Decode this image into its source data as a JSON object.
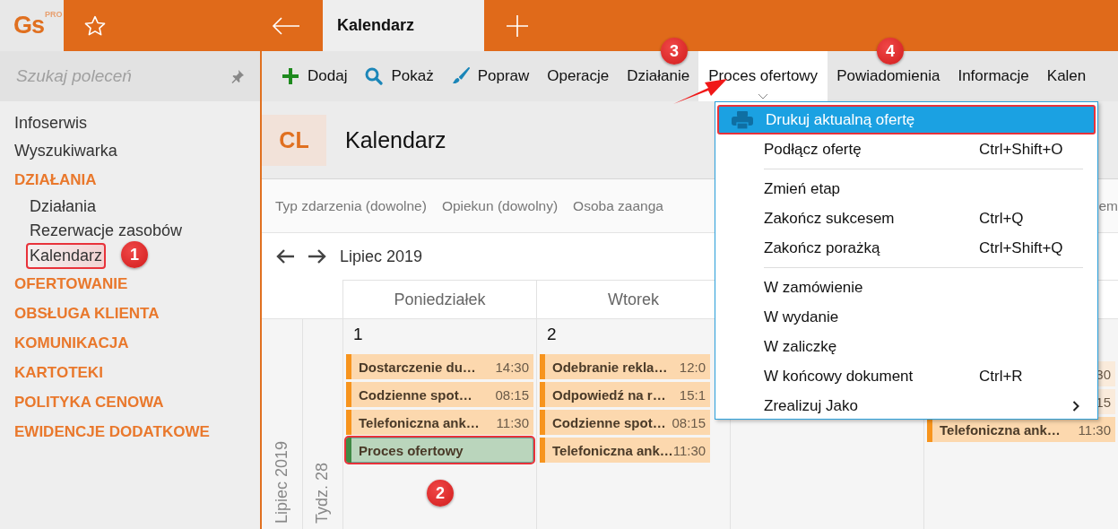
{
  "app": {
    "logo": "Gs",
    "logo_badge": "PRO"
  },
  "top_bar": {
    "tab": {
      "label": "Kalendarz",
      "selected": true
    }
  },
  "sidebar": {
    "search": {
      "placeholder": "Szukaj poleceń"
    },
    "items": [
      {
        "kind": "link",
        "label": "Infoserwis"
      },
      {
        "kind": "link",
        "label": "Wyszukiwarka"
      },
      {
        "kind": "section",
        "label": "DZIAŁANIA",
        "children": [
          {
            "label": "Działania",
            "selected": false
          },
          {
            "label": "Rezerwacje zasobów",
            "selected": false
          },
          {
            "label": "Kalendarz",
            "selected": true
          }
        ]
      },
      {
        "kind": "section",
        "label": "OFERTOWANIE"
      },
      {
        "kind": "section",
        "label": "OBSŁUGA KLIENTA"
      },
      {
        "kind": "section",
        "label": "KOMUNIKACJA"
      },
      {
        "kind": "section",
        "label": "KARTOTEKI"
      },
      {
        "kind": "section",
        "label": "POLITYKA CENOWA"
      },
      {
        "kind": "section",
        "label": "EWIDENCJE DODATKOWE"
      }
    ]
  },
  "toolbar": {
    "items": [
      {
        "kind": "add",
        "label": "Dodaj",
        "selected": false
      },
      {
        "kind": "search",
        "label": "Pokaż",
        "selected": false
      },
      {
        "kind": "edit",
        "label": "Popraw",
        "selected": false
      },
      {
        "kind": "plain",
        "label": "Operacje",
        "selected": false
      },
      {
        "kind": "plain",
        "label": "Działanie",
        "selected": false
      },
      {
        "kind": "plain",
        "label": "Proces ofertowy",
        "selected": true
      },
      {
        "kind": "plain",
        "label": "Powiadomienia",
        "selected": false
      },
      {
        "kind": "plain",
        "label": "Informacje",
        "selected": false
      },
      {
        "kind": "plain",
        "label": "Kalen",
        "selected": false
      }
    ]
  },
  "page_header": {
    "badge": "CL",
    "title": "Kalendarz"
  },
  "filters": [
    "Typ zdarzenia (dowolne)",
    "Opiekun (dowolny)",
    "Osoba zaanga",
    "em"
  ],
  "navigation": {
    "period": "Lipiec 2019"
  },
  "calendar": {
    "month_label": "Lipiec 2019",
    "week_label": "Tydz. 28",
    "columns": [
      {
        "header": "Poniedziałek",
        "day": "1",
        "events": [
          {
            "title": "Dostarczenie du…",
            "time": "14:30",
            "color": "#f7941d",
            "selected": false
          },
          {
            "title": "Codzienne spot…",
            "time": "08:15",
            "color": "#f7941d",
            "selected": false
          },
          {
            "title": "Telefoniczna ank…",
            "time": "11:30",
            "color": "#f7941d",
            "selected": false
          },
          {
            "title": "Proces ofertowy",
            "color": "#3f8a45",
            "selected": true
          }
        ]
      },
      {
        "header": "Wtorek",
        "day": "2",
        "events": [
          {
            "title": "Odebranie rekla…",
            "time": "12:0",
            "color": "#f7941d",
            "selected": false
          },
          {
            "title": "Odpowiedź na r…",
            "time": "15:1",
            "color": "#f7941d",
            "selected": false
          },
          {
            "title": "Codzienne spot…",
            "time": "08:15",
            "color": "#f7941d",
            "selected": false
          },
          {
            "title": "Telefoniczna ank…",
            "time": "11:30",
            "color": "#f7941d",
            "selected": false
          }
        ]
      },
      {},
      {
        "events": [
          {
            "time": "30",
            "selected": false
          },
          {
            "time": "15",
            "selected": false
          },
          {
            "title": "Telefoniczna ank…",
            "time": "11:30",
            "color": "#f7941d",
            "selected": false
          }
        ]
      }
    ]
  },
  "menu": {
    "items": [
      {
        "kind": "item",
        "label": "Drukuj aktualną ofertę",
        "selected": true,
        "submenu": false
      },
      {
        "kind": "item",
        "label": "Podłącz ofertę",
        "shortcut": "Ctrl+Shift+O",
        "selected": false,
        "submenu": false
      },
      {
        "kind": "separator"
      },
      {
        "kind": "item",
        "label": "Zmień etap",
        "selected": false,
        "submenu": false
      },
      {
        "kind": "item",
        "label": "Zakończ sukcesem",
        "shortcut": "Ctrl+Q",
        "selected": false,
        "submenu": false
      },
      {
        "kind": "item",
        "label": "Zakończ porażką",
        "shortcut": "Ctrl+Shift+Q",
        "selected": false,
        "submenu": false
      },
      {
        "kind": "separator"
      },
      {
        "kind": "item",
        "label": "W zamówienie",
        "selected": false,
        "submenu": false
      },
      {
        "kind": "item",
        "label": "W wydanie",
        "selected": false,
        "submenu": false
      },
      {
        "kind": "item",
        "label": "W zaliczkę",
        "selected": false,
        "submenu": false
      },
      {
        "kind": "item",
        "label": "W końcowy dokument",
        "shortcut": "Ctrl+R",
        "selected": false,
        "submenu": false
      },
      {
        "kind": "item",
        "label": "Zrealizuj Jako",
        "selected": false,
        "submenu": true
      }
    ]
  },
  "annotations": [
    {
      "label": "1"
    },
    {
      "label": "2"
    },
    {
      "label": "3"
    },
    {
      "label": "4"
    }
  ]
}
